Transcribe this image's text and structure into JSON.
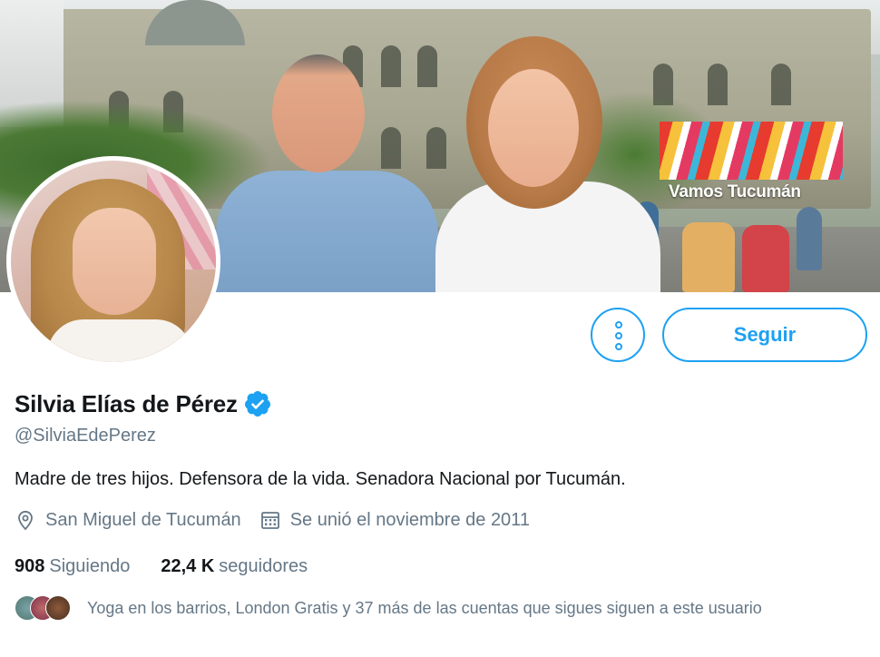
{
  "banner": {
    "campaign_text": "Vamos Tucumán"
  },
  "actions": {
    "follow_label": "Seguir",
    "more_icon": "more-vertical-icon"
  },
  "profile": {
    "name": "Silvia Elías de Pérez",
    "verified": true,
    "handle": "@SilviaEdePerez",
    "bio": "Madre de tres hijos. Defensora de la vida. Senadora Nacional por Tucumán.",
    "location": "San Miguel de Tucumán",
    "joined": "Se unió el noviembre de 2011"
  },
  "stats": {
    "following_count": "908",
    "following_label": "Siguiendo",
    "followers_count": "22,4 K",
    "followers_label": "seguidores"
  },
  "followed_by": {
    "text": "Yoga en los barrios, London Gratis y 37 más de las cuentas que sigues siguen a este usuario"
  },
  "colors": {
    "accent": "#1da1f2",
    "secondary_text": "#657786",
    "primary_text": "#14171a"
  }
}
